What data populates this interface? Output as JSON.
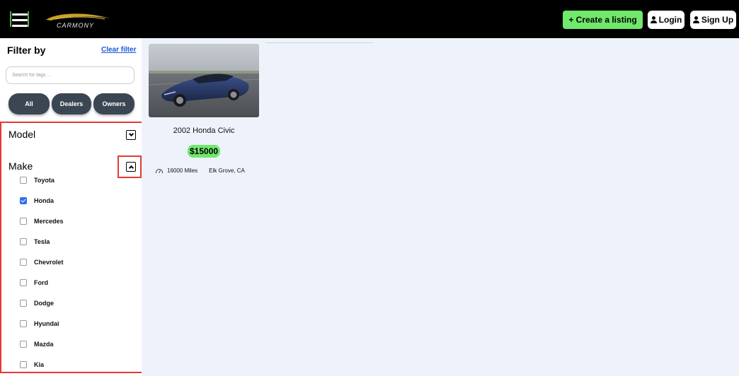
{
  "header": {
    "logo_text": "CARMONY",
    "create_listing_label": "+ Create a listing",
    "login_label": "Login",
    "signup_label": "Sign Up"
  },
  "sidebar": {
    "title": "Filter by",
    "clear_filter": "Clear filter",
    "search_placeholder": "Search for tags ...",
    "segments": [
      "All",
      "Dealers",
      "Owners"
    ],
    "model_label": "Model",
    "make_label": "Make",
    "makes": [
      {
        "name": "Toyota",
        "checked": false
      },
      {
        "name": "Honda",
        "checked": true
      },
      {
        "name": "Mercedes",
        "checked": false
      },
      {
        "name": "Tesla",
        "checked": false
      },
      {
        "name": "Chevrolet",
        "checked": false
      },
      {
        "name": "Ford",
        "checked": false
      },
      {
        "name": "Dodge",
        "checked": false
      },
      {
        "name": "Hyundai",
        "checked": false
      },
      {
        "name": "Mazda",
        "checked": false
      },
      {
        "name": "Kia",
        "checked": false
      }
    ]
  },
  "listing": {
    "title": "2002 Honda Civic",
    "price": "$15000",
    "mileage": "16000 Miles",
    "location": "Elk Grove, CA"
  },
  "colors": {
    "accent_green": "#6fe86b",
    "highlight_red": "#e53935",
    "topbar": "#000000",
    "segment_bg": "#3b4653"
  }
}
